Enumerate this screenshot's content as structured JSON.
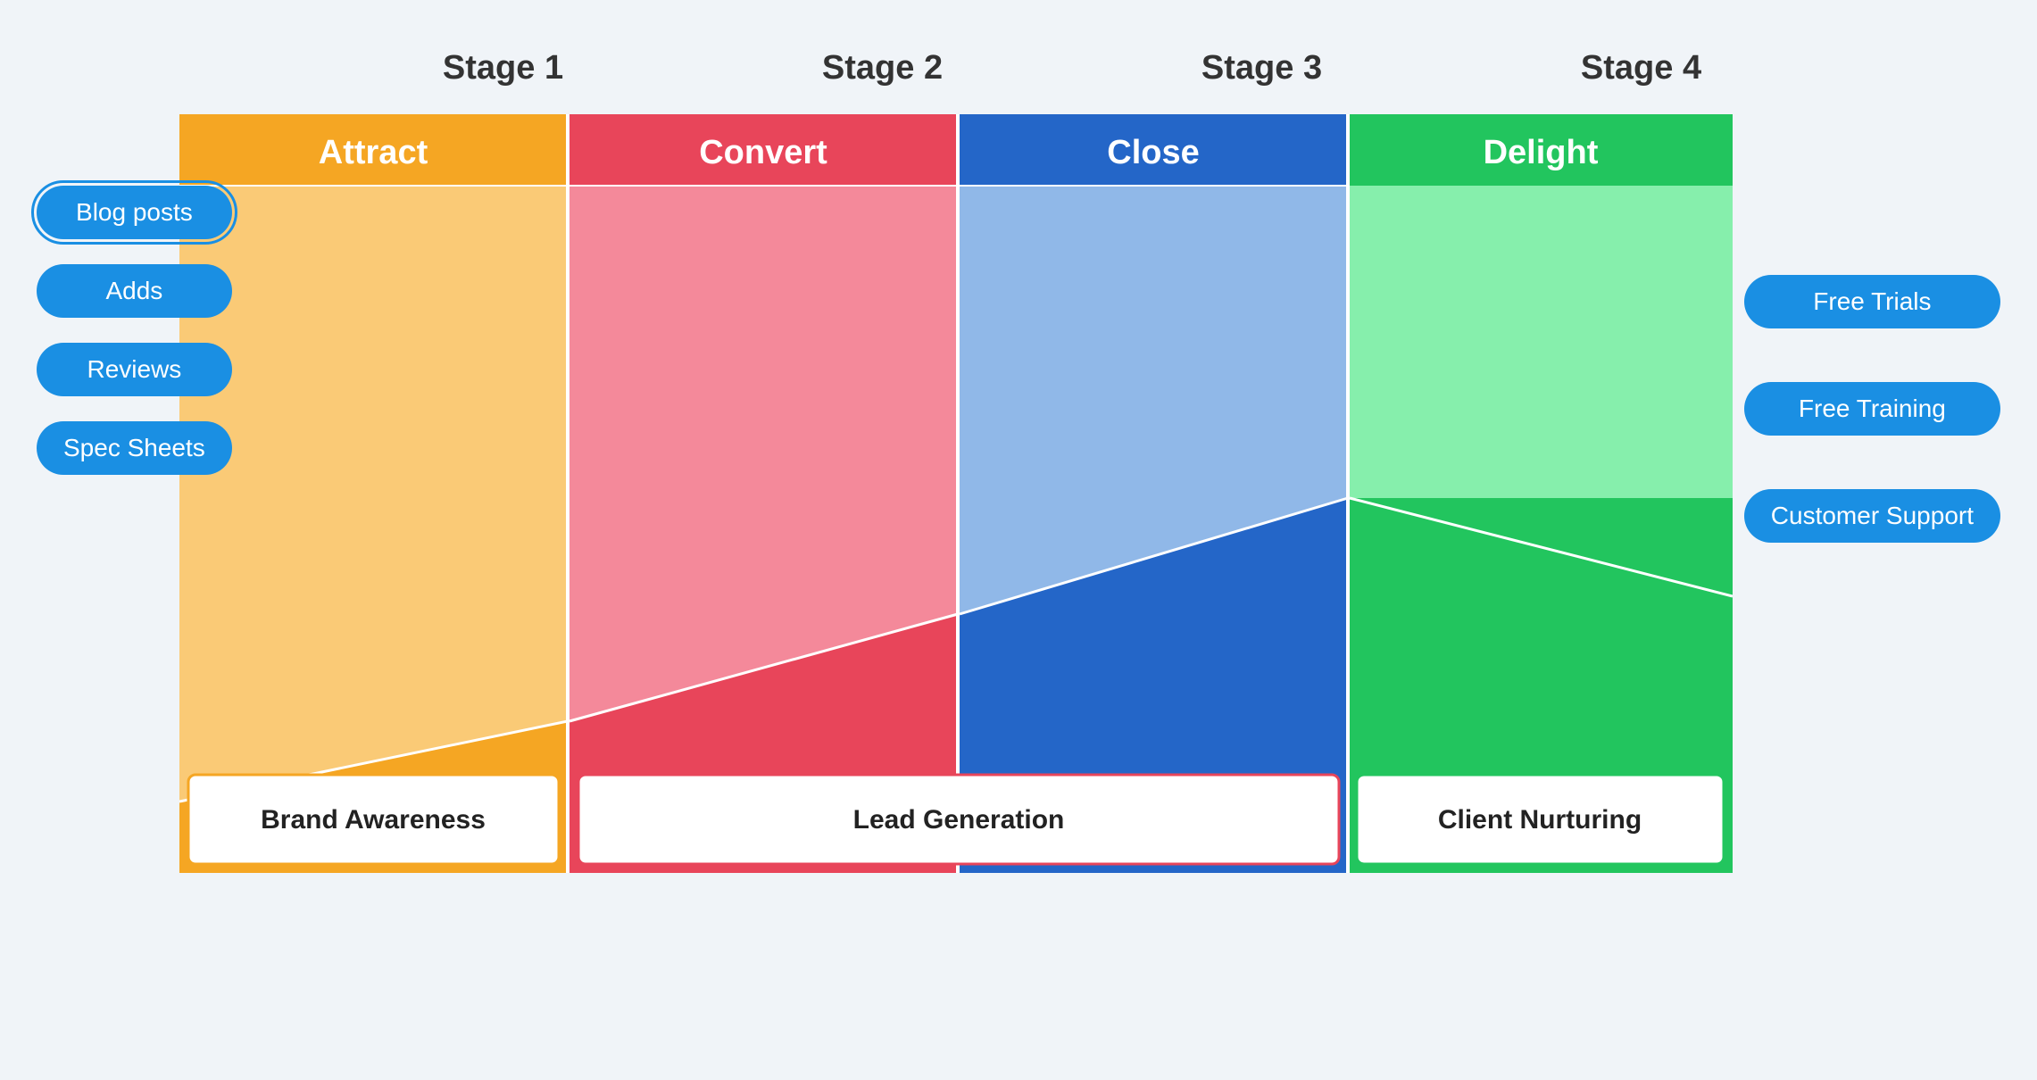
{
  "stages": [
    {
      "label": "Stage 1"
    },
    {
      "label": "Stage 2"
    },
    {
      "label": "Stage 3"
    },
    {
      "label": "Stage 4"
    }
  ],
  "columns": [
    {
      "id": "attract",
      "title": "Attract",
      "color_dark": "#F5A623",
      "color_light": "#FACA76",
      "border_color": "#F5A623"
    },
    {
      "id": "convert",
      "title": "Convert",
      "color_dark": "#E8455A",
      "color_light": "#F4899A",
      "border_color": "#E8455A"
    },
    {
      "id": "close",
      "title": "Close",
      "color_dark": "#2466C8",
      "color_light": "#90B8E8",
      "border_color": "#2466C8"
    },
    {
      "id": "delight",
      "title": "Delight",
      "color_dark": "#22C55E",
      "color_light": "#86EFAC",
      "border_color": "#22C55E"
    }
  ],
  "left_pills": [
    {
      "label": "Blog posts",
      "selected": true
    },
    {
      "label": "Adds",
      "selected": false
    },
    {
      "label": "Reviews",
      "selected": false
    },
    {
      "label": "Spec Sheets",
      "selected": false
    }
  ],
  "right_pills": [
    {
      "label": "Free Trials"
    },
    {
      "label": "Free Training"
    },
    {
      "label": "Customer Support"
    }
  ],
  "bottom_labels": [
    {
      "label": "Brand Awareness",
      "color": "#F5A623"
    },
    {
      "label": "Lead Generation",
      "color": "#E8455A"
    },
    {
      "label": "Client Nurturing",
      "color": "#22C55E"
    }
  ]
}
